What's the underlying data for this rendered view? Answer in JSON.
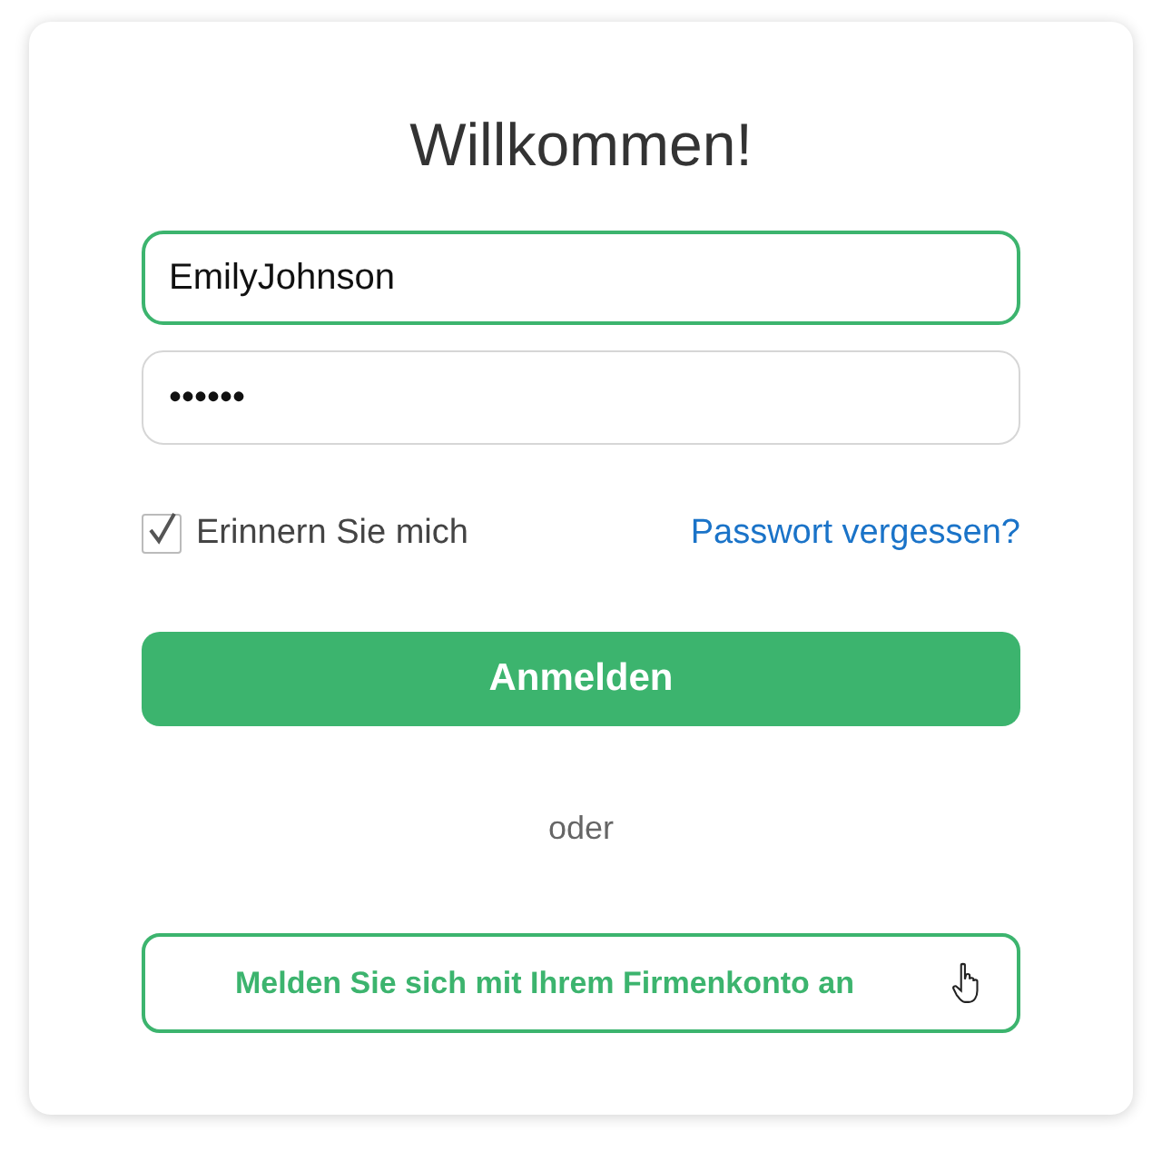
{
  "title": "Willkommen!",
  "username": {
    "value": "EmilyJohnson",
    "focused": true
  },
  "password": {
    "value": "••••••",
    "focused": false
  },
  "remember": {
    "label": "Erinnern Sie mich",
    "checked": true
  },
  "forgot_link": "Passwort vergessen?",
  "login_button": "Anmelden",
  "separator": "oder",
  "company_button": "Melden Sie sich mit Ihrem Firmenkonto an"
}
